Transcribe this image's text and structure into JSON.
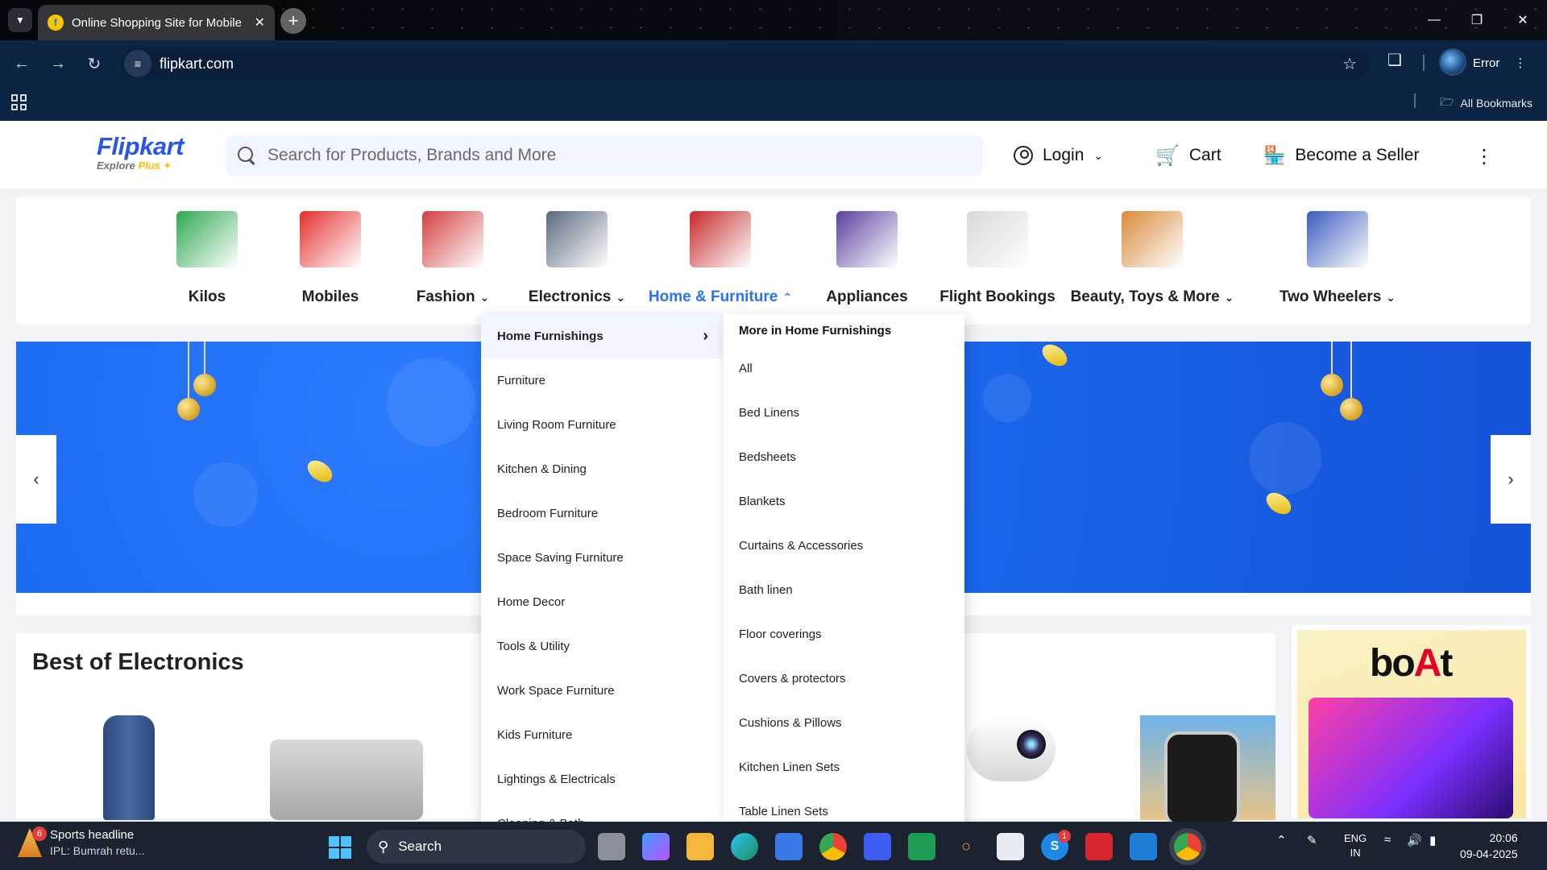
{
  "browser": {
    "tab_title": "Online Shopping Site for Mobile",
    "url": "flipkart.com",
    "profile_status": "Error",
    "all_bookmarks": "All Bookmarks"
  },
  "header": {
    "logo": "Flipkart",
    "logo_sub": "Explore",
    "logo_plus": "Plus",
    "search_placeholder": "Search for Products, Brands and More",
    "login": "Login",
    "cart": "Cart",
    "seller": "Become a Seller"
  },
  "categories": [
    {
      "label": "Kilos",
      "color": "#2fa84f"
    },
    {
      "label": "Mobiles",
      "color": "#e52d2d"
    },
    {
      "label": "Fashion",
      "color": "#d23f3f"
    },
    {
      "label": "Electronics",
      "color": "#5a6a80"
    },
    {
      "label": "Home & Furniture",
      "color": "#c62828"
    },
    {
      "label": "Appliances",
      "color": "#5b3fa0"
    },
    {
      "label": "Flight Bookings",
      "color": "#d9d9d9"
    },
    {
      "label": "Beauty, Toys & More",
      "color": "#d98a3a"
    },
    {
      "label": "Two Wheelers",
      "color": "#3a5bbd"
    }
  ],
  "dropdown": {
    "left": [
      "Home Furnishings",
      "Furniture",
      "Living Room Furniture",
      "Kitchen & Dining",
      "Bedroom Furniture",
      "Space Saving Furniture",
      "Home Decor",
      "Tools & Utility",
      "Work Space Furniture",
      "Kids Furniture",
      "Lightings & Electricals",
      "Cleaning & Bath"
    ],
    "right_heading": "More in Home Furnishings",
    "right": [
      "All",
      "Bed Linens",
      "Bedsheets",
      "Blankets",
      "Curtains & Accessories",
      "Bath linen",
      "Floor coverings",
      "Covers & protectors",
      "Cushions & Pillows",
      "Kitchen Linen Sets",
      "Table Linen Sets"
    ]
  },
  "sections": {
    "best_electronics": "Best of Electronics",
    "boat_brand_a": "bo",
    "boat_brand_b": "A",
    "boat_brand_c": "t"
  },
  "taskbar": {
    "news_headline": "Sports headline",
    "news_sub": "IPL: Bumrah retu...",
    "news_badge": "6",
    "search": "Search",
    "skype_badge": "1",
    "lang_1": "ENG",
    "lang_2": "IN",
    "time": "20:06",
    "date": "09-04-2025"
  }
}
